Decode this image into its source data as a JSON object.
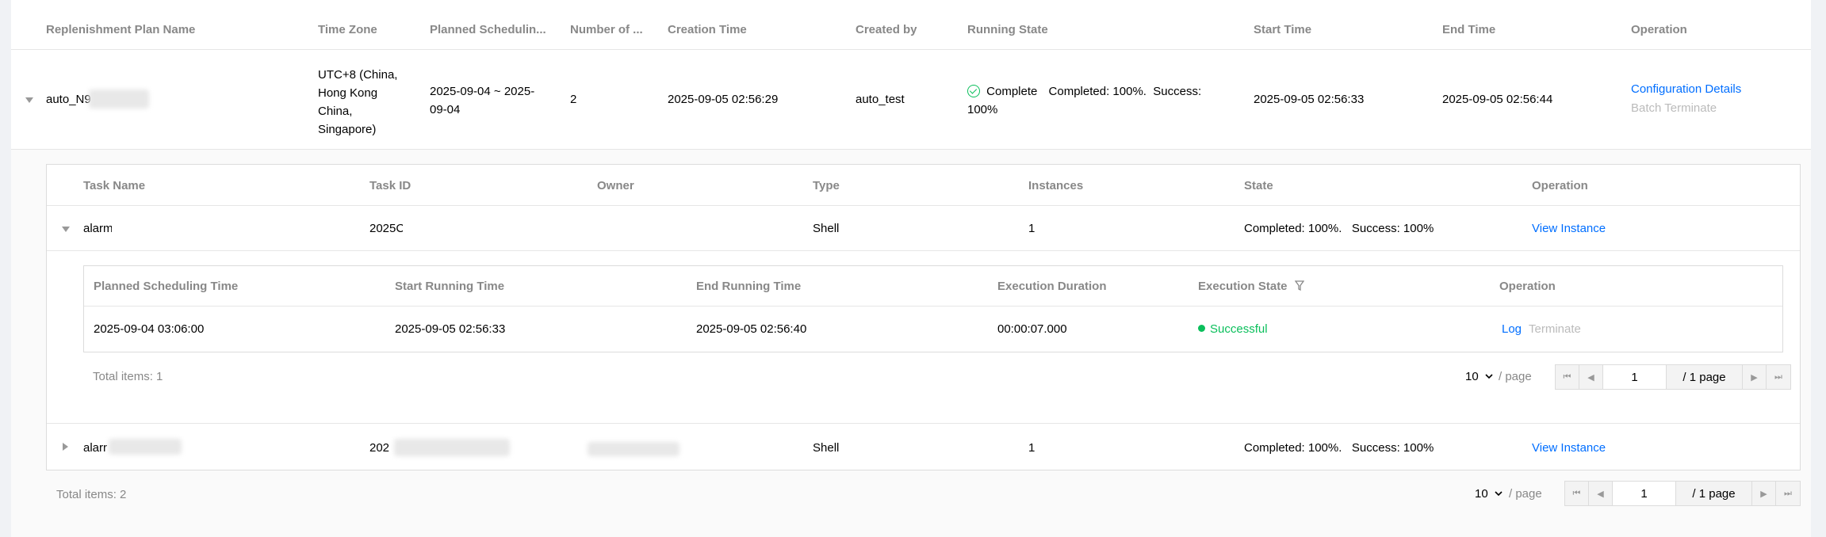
{
  "plan_table": {
    "headers": [
      "Replenishment Plan Name",
      "Time Zone",
      "Planned Schedulin...",
      "Number of ...",
      "Creation Time",
      "Created by",
      "Running State",
      "Start Time",
      "End Time",
      "Operation"
    ],
    "row": {
      "name": "auto_N9",
      "time_zone_lines": [
        "UTC+8 (China,",
        "Hong Kong",
        "China,",
        "Singapore)"
      ],
      "planned_lines": [
        "2025-09-04 ~ 2025-",
        "09-04"
      ],
      "number": "2",
      "creation_time": "2025-09-05 02:56:29",
      "created_by": "auto_test",
      "running_state_label": "Complete",
      "running_state_detail_line1": "Completed: 100%.  Success:",
      "running_state_detail_line2": "100%",
      "start_time": "2025-09-05 02:56:33",
      "end_time": "2025-09-05 02:56:44",
      "op_config": "Configuration Details",
      "op_batch": "Batch Terminate"
    },
    "total": "Total items:  2",
    "pager": {
      "page_size": "10",
      "per_page": "/ page",
      "page": "1",
      "total_pages": "/ 1 page"
    }
  },
  "task_table": {
    "headers": [
      "Task Name",
      "Task ID",
      "Owner",
      "Type",
      "Instances",
      "State",
      "Operation"
    ],
    "rows": [
      {
        "name": "alarm",
        "task_id": "2025C",
        "type": "Shell",
        "instances": "1",
        "state": "Completed: 100%.   Success: 100%",
        "op": "View Instance"
      },
      {
        "name": "alarr",
        "task_id": "202",
        "type": "Shell",
        "instances": "1",
        "state": "Completed: 100%.   Success: 100%",
        "op": "View Instance"
      }
    ]
  },
  "instance_table": {
    "headers": [
      "Planned Scheduling Time",
      "Start Running Time",
      "End Running Time",
      "Execution Duration",
      "Execution State",
      "Operation"
    ],
    "row": {
      "planned": "2025-09-04 03:06:00",
      "start": "2025-09-05 02:56:33",
      "end": "2025-09-05 02:56:40",
      "duration": "00:00:07.000",
      "state": "Successful",
      "op_log": "Log",
      "op_terminate": "Terminate"
    },
    "total": "Total items:  1",
    "pager": {
      "page_size": "10",
      "per_page": "/ page",
      "page": "1",
      "total_pages": "/ 1 page"
    }
  },
  "colors": {
    "link": "#006eff",
    "success": "#0abf5b",
    "header_text": "#888888"
  }
}
